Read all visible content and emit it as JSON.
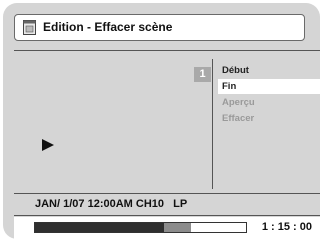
{
  "header": {
    "title": "Edition - Effacer scène",
    "icon": "disc-tray-icon"
  },
  "video": {
    "chapter_badge": "1",
    "play_icon": "play-icon"
  },
  "menu": {
    "items": [
      {
        "label": "Début",
        "state": "normal"
      },
      {
        "label": "Fin",
        "state": "selected"
      },
      {
        "label": "Aperçu",
        "state": "disabled"
      },
      {
        "label": "Effacer",
        "state": "disabled"
      }
    ]
  },
  "recording_info": "JAN/ 1/07 12:00AM CH10   LP",
  "playback": {
    "time": "1 : 15 : 00",
    "progress_fraction": 0.61,
    "marker_fraction": 0.74
  },
  "colors": {
    "background": "#d5d5d5",
    "selected": "#ffffff",
    "disabled_text": "#9a9a9a",
    "progress_fill": "#2f2f2f"
  }
}
